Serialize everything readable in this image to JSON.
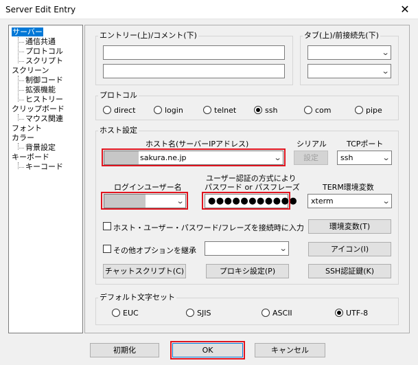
{
  "window": {
    "title": "Server Edit Entry",
    "close_glyph": "✕"
  },
  "tree": {
    "items": [
      {
        "label": "サーバー",
        "selected": true
      },
      {
        "label": "通信共通"
      },
      {
        "label": "プロトコル"
      },
      {
        "label": "スクリプト"
      },
      {
        "label": "スクリーン"
      },
      {
        "label": "制御コード"
      },
      {
        "label": "拡張機能"
      },
      {
        "label": "ヒストリー"
      },
      {
        "label": "クリップボード"
      },
      {
        "label": "マウス関連"
      },
      {
        "label": "フォント"
      },
      {
        "label": "カラー"
      },
      {
        "label": "背景設定"
      },
      {
        "label": "キーボード"
      },
      {
        "label": "キーコード"
      }
    ]
  },
  "entry": {
    "group_label": "エントリー(上)/コメント(下)",
    "entry_value": "",
    "comment_value": ""
  },
  "tab": {
    "group_label": "タブ(上)/前接続先(下)"
  },
  "protocol": {
    "group_label": "プロトコル",
    "options": [
      "direct",
      "login",
      "telnet",
      "ssh",
      "com",
      "pipe"
    ],
    "selected": "ssh"
  },
  "host": {
    "group_label": "ホスト設定",
    "hostname_label": "ホスト名(サーバーIPアドレス)",
    "hostname_value": "sakura.ne.jp",
    "serial_label": "シリアル",
    "serial_button": "設定",
    "tcp_label": "TCPポート",
    "tcp_value": "ssh",
    "login_user_label": "ログインユーザー名",
    "login_user_value": "",
    "auth_label_line1": "ユーザー認証の方式により",
    "auth_label_line2": "パスワード or パスフレーズ",
    "password_mask": "●●●●●●●●●●●",
    "term_label": "TERM環境変数",
    "term_value": "xterm",
    "check_input_on_connect": "ホスト・ユーザー・パスワード/フレーズを接続時に入力",
    "env_button": "環境変数(T)",
    "check_other_options": "その他オプションを継承",
    "icon_button": "アイコン(I)",
    "chat_script_button": "チャットスクリプト(C)",
    "proxy_button": "プロキシ設定(P)",
    "ssh_auth_button": "SSH認証鍵(K)"
  },
  "charset": {
    "group_label": "デフォルト文字セット",
    "options": [
      "EUC",
      "SJIS",
      "ASCII",
      "UTF-8"
    ],
    "selected": "UTF-8"
  },
  "footer": {
    "init_button": "初期化",
    "ok_button": "OK",
    "cancel_button": "キャンセル"
  },
  "colors": {
    "accent": "#0078d7",
    "highlight_box": "#e0141e"
  }
}
